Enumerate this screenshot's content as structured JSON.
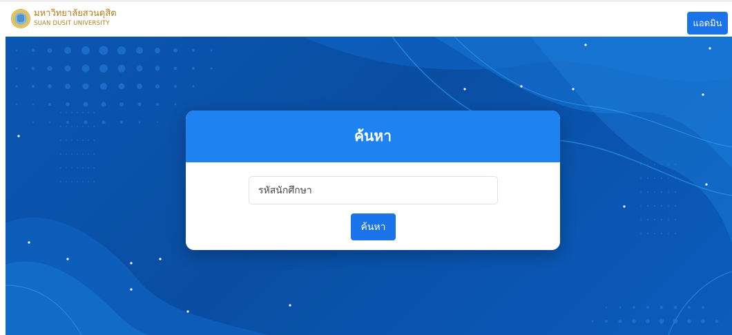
{
  "header": {
    "logo_icon": "university-emblem-icon",
    "university_name_thai": "มหาวิทยาลัยสวนดุสิต",
    "university_name_english": "SUAN DUSIT UNIVERSITY",
    "admin_button_label": "แอดมิน"
  },
  "search_card": {
    "title": "ค้นหา",
    "student_id_placeholder": "รหัสนักศึกษา",
    "student_id_value": "",
    "search_button_label": "ค้นหา"
  },
  "colors": {
    "accent": "#1a73e8",
    "card_header": "#1e82f0",
    "background": "#0b56b2",
    "brand_text": "#b07d1a"
  }
}
